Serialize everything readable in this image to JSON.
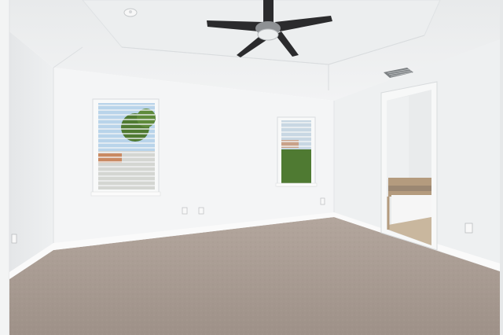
{
  "scene": {
    "subject": "empty-bedroom",
    "colors": {
      "wall_left": "#edeff0",
      "wall_back": "#f4f5f6",
      "wall_right": "#eef0f1",
      "ceiling": "#f1f2f3",
      "tray_ceiling": "#ebedee",
      "carpet": "#a89b91",
      "baseboard": "#fafafa",
      "fan_blade": "#2b2b2d",
      "sky": "#b9d4ea",
      "foliage": "#4f7a32",
      "tub_tile": "#b49b7e"
    },
    "icons": [
      "ceiling-fan-icon",
      "smoke-detector-icon",
      "air-vent-icon",
      "power-outlet-icon"
    ]
  }
}
